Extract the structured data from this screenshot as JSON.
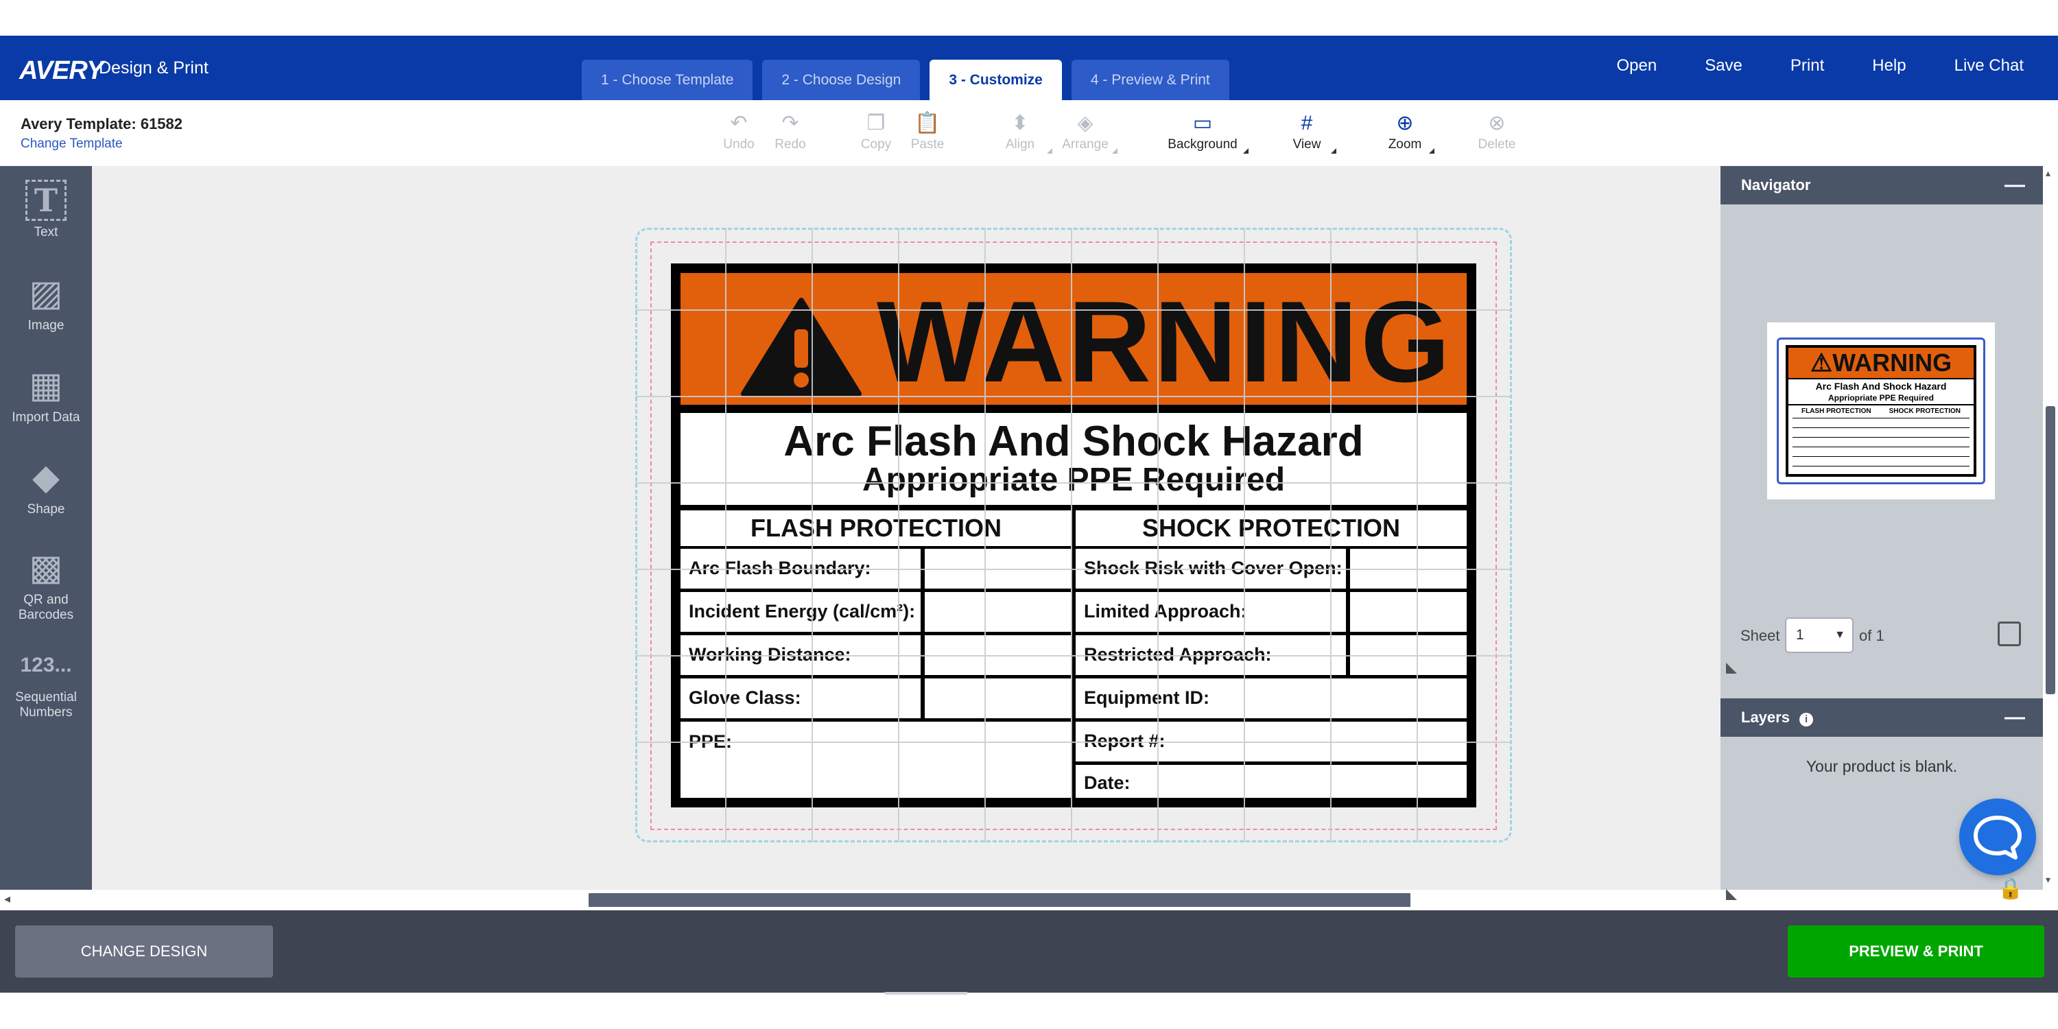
{
  "header": {
    "logo": "AVERY",
    "brand": "Design & Print",
    "steps": [
      {
        "label": "1 - Choose Template"
      },
      {
        "label": "2 - Choose Design"
      },
      {
        "label": "3 - Customize"
      },
      {
        "label": "4 - Preview & Print"
      }
    ],
    "nav": [
      "Open",
      "Save",
      "Print",
      "Help",
      "Live Chat"
    ]
  },
  "toolbar": {
    "template_title": "Avery Template: 61582",
    "change_template": "Change Template",
    "tools": [
      {
        "label": "Undo",
        "icon": "undo-icon",
        "glyph": "↶"
      },
      {
        "label": "Redo",
        "icon": "redo-icon",
        "glyph": "↷"
      },
      {
        "label": "Copy",
        "icon": "copy-icon",
        "glyph": "❐"
      },
      {
        "label": "Paste",
        "icon": "paste-icon",
        "glyph": "📋"
      },
      {
        "label": "Align",
        "icon": "align-icon",
        "glyph": "⬍"
      },
      {
        "label": "Arrange",
        "icon": "arrange-icon",
        "glyph": "◈"
      },
      {
        "label": "Background",
        "icon": "background-icon",
        "glyph": "▭"
      },
      {
        "label": "View",
        "icon": "grid-icon",
        "glyph": "#"
      },
      {
        "label": "Zoom",
        "icon": "zoom-icon",
        "glyph": "⊕"
      },
      {
        "label": "Delete",
        "icon": "delete-icon",
        "glyph": "⊗"
      }
    ]
  },
  "left_tools": [
    {
      "label": "Text",
      "icon": "text-icon",
      "glyph": "T"
    },
    {
      "label": "Image",
      "icon": "image-icon",
      "glyph": "▨"
    },
    {
      "label": "Import Data",
      "icon": "import-data-icon",
      "glyph": "▦"
    },
    {
      "label": "Shape",
      "icon": "shape-icon",
      "glyph": "◆"
    },
    {
      "label": "QR and Barcodes",
      "icon": "qr-icon",
      "glyph": "▩"
    },
    {
      "label": "Sequential Numbers",
      "icon": "sequential-numbers-icon",
      "glyph": "123..."
    }
  ],
  "sign": {
    "banner": "WARNING",
    "title": "Arc Flash And Shock Hazard",
    "subtitle": "Appriopriate PPE Required",
    "left_header": "FLASH PROTECTION",
    "right_header": "SHOCK PROTECTION",
    "left_rows": [
      "Arc Flash Boundary:",
      "Incident Energy (cal/cm²):",
      "Working Distance:",
      "Glove Class:",
      "PPE:"
    ],
    "right_rows": [
      "Shock Risk with Cover Open:",
      "Limited Approach:",
      "Restricted Approach:",
      "Equipment ID:",
      "Report #:",
      "Date:"
    ],
    "colors": {
      "banner": "#e2600c",
      "frame": "#000000"
    }
  },
  "navigator": {
    "title": "Navigator",
    "sheet_label": "Sheet",
    "sheet_value": "1",
    "sheet_of": "of 1"
  },
  "layers": {
    "title": "Layers",
    "empty": "Your product is blank."
  },
  "footer": {
    "change_design": "CHANGE DESIGN",
    "preview_print": "PREVIEW & PRINT"
  },
  "colors": {
    "header": "#0a3aa7",
    "sidebar": "#4a5568",
    "preview_button": "#00a600"
  }
}
